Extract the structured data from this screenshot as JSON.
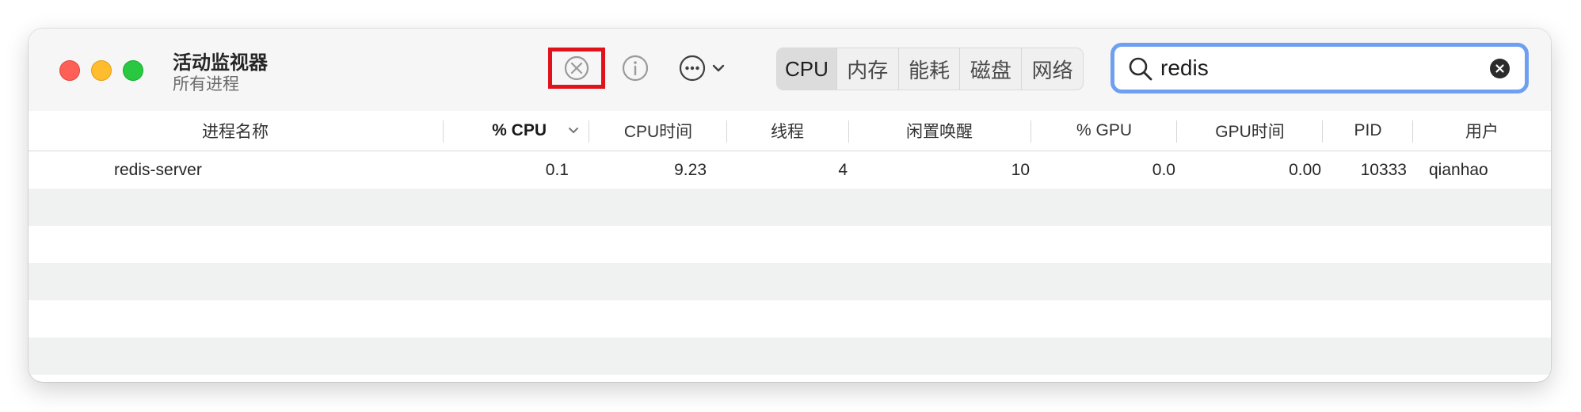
{
  "window": {
    "title": "活动监视器",
    "subtitle": "所有进程"
  },
  "toolbar": {
    "stop_icon": "xmark-circle-icon",
    "info_icon": "info-circle-icon",
    "more_icon": "ellipsis-circle-icon",
    "highlight_color": "#e0121a"
  },
  "tabs": [
    "CPU",
    "内存",
    "能耗",
    "磁盘",
    "网络"
  ],
  "selected_tab": "CPU",
  "search": {
    "value": "redis",
    "accent": "#6f9ff0"
  },
  "columns": [
    "进程名称",
    "% CPU",
    "CPU时间",
    "线程",
    "闲置唤醒",
    "% GPU",
    "GPU时间",
    "PID",
    "用户"
  ],
  "sort_column": "% CPU",
  "rows": [
    [
      "redis-server",
      "0.1",
      "9.23",
      "4",
      "10",
      "0.0",
      "0.00",
      "10333",
      "qianhao"
    ]
  ]
}
